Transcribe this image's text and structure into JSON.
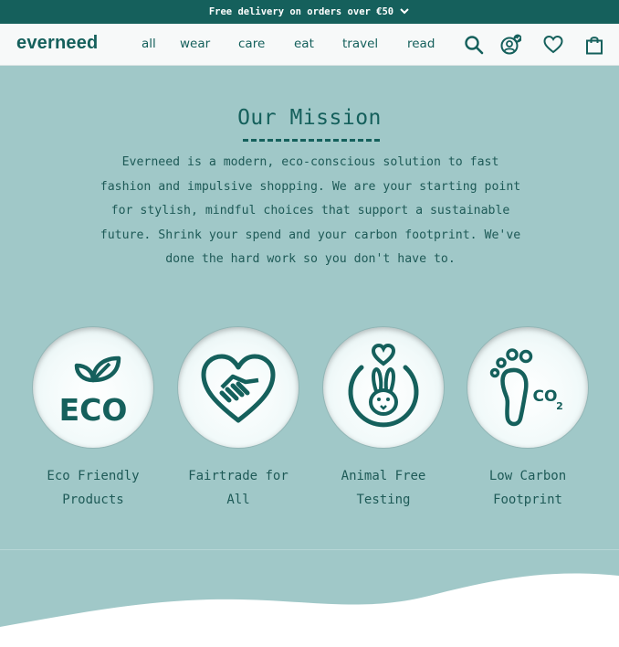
{
  "promo": {
    "text": "Free delivery on orders over €50"
  },
  "header": {
    "logo": "everneed",
    "nav": [
      "all",
      "wear",
      "care",
      "eat",
      "travel",
      "read"
    ]
  },
  "mission": {
    "title": "Our Mission",
    "lines": [
      "Everneed is a modern, eco-conscious solution to fast",
      "fashion and impulsive shopping. We are your starting point",
      "for stylish, mindful choices that support a sustainable",
      "future. Shrink your spend and your carbon footprint. We've",
      "done the hard work so you don't have to."
    ]
  },
  "features": [
    {
      "icon": "eco-leaf-icon",
      "line1": "Eco Friendly",
      "line2": "Products"
    },
    {
      "icon": "heart-handshake-icon",
      "line1": "Fairtrade for",
      "line2": "All"
    },
    {
      "icon": "rabbit-heart-icon",
      "line1": "Animal Free",
      "line2": "Testing"
    },
    {
      "icon": "footprint-co2-icon",
      "line1": "Low Carbon",
      "line2": "Footprint"
    }
  ],
  "colors": {
    "brand": "#15605c",
    "background": "#a0c8c8",
    "header": "#f7f9f9"
  }
}
